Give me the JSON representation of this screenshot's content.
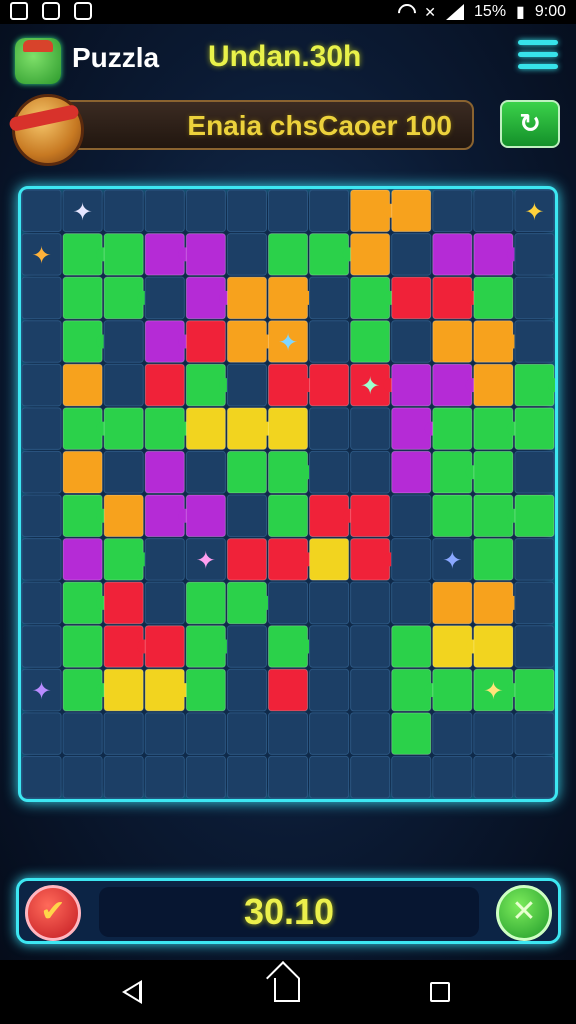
{
  "status_bar": {
    "battery": "15%",
    "time": "9:00"
  },
  "header": {
    "app_name": "Puzzla",
    "timer_label": "Undan.30h"
  },
  "challenge": {
    "text": "Enaia chsCaoer 100"
  },
  "score": {
    "value": "30.10"
  },
  "colors": {
    "accent": "#3de7f2",
    "title_yellow": "#e9f24a",
    "board_bg": "#0f2a4a"
  },
  "board": {
    "rows": 14,
    "cols": 13,
    "palette": {
      "G": "#2bd14a",
      "g": "#1f9e3a",
      "O": "#f7a21d",
      "o": "#ff7a12",
      "R": "#f02239",
      "P": "#b52bd6",
      "p": "#e02bc8",
      "Y": "#f2d41f",
      "B": "#1c3f66"
    },
    "grid": [
      "BBBBBBBBOOBBB",
      "BGGPPBGGOBPPB",
      "BGGBPOOBGRRGB",
      "BGBPROOBGBOOB",
      "BOBRGBRRRPPOG",
      "BGGGYYYBBPGGG",
      "BOBPBGGBBPGGB",
      "BGOPPBGRRBGGG",
      "BPGBBRRYRBBGB",
      "BGRBGGBBBBOOB",
      "BGRRGBGBBGYYB",
      "BGYYGBRBBGGGG",
      "BBBBBBBBBGBBB",
      "BBBBBBBBBBBBB"
    ]
  },
  "icons": {
    "battery": "battery-icon",
    "menu": "hamburger-menu-icon",
    "refresh": "refresh-icon",
    "hint": "check-hint-icon",
    "confirm": "cross-swords-icon"
  }
}
